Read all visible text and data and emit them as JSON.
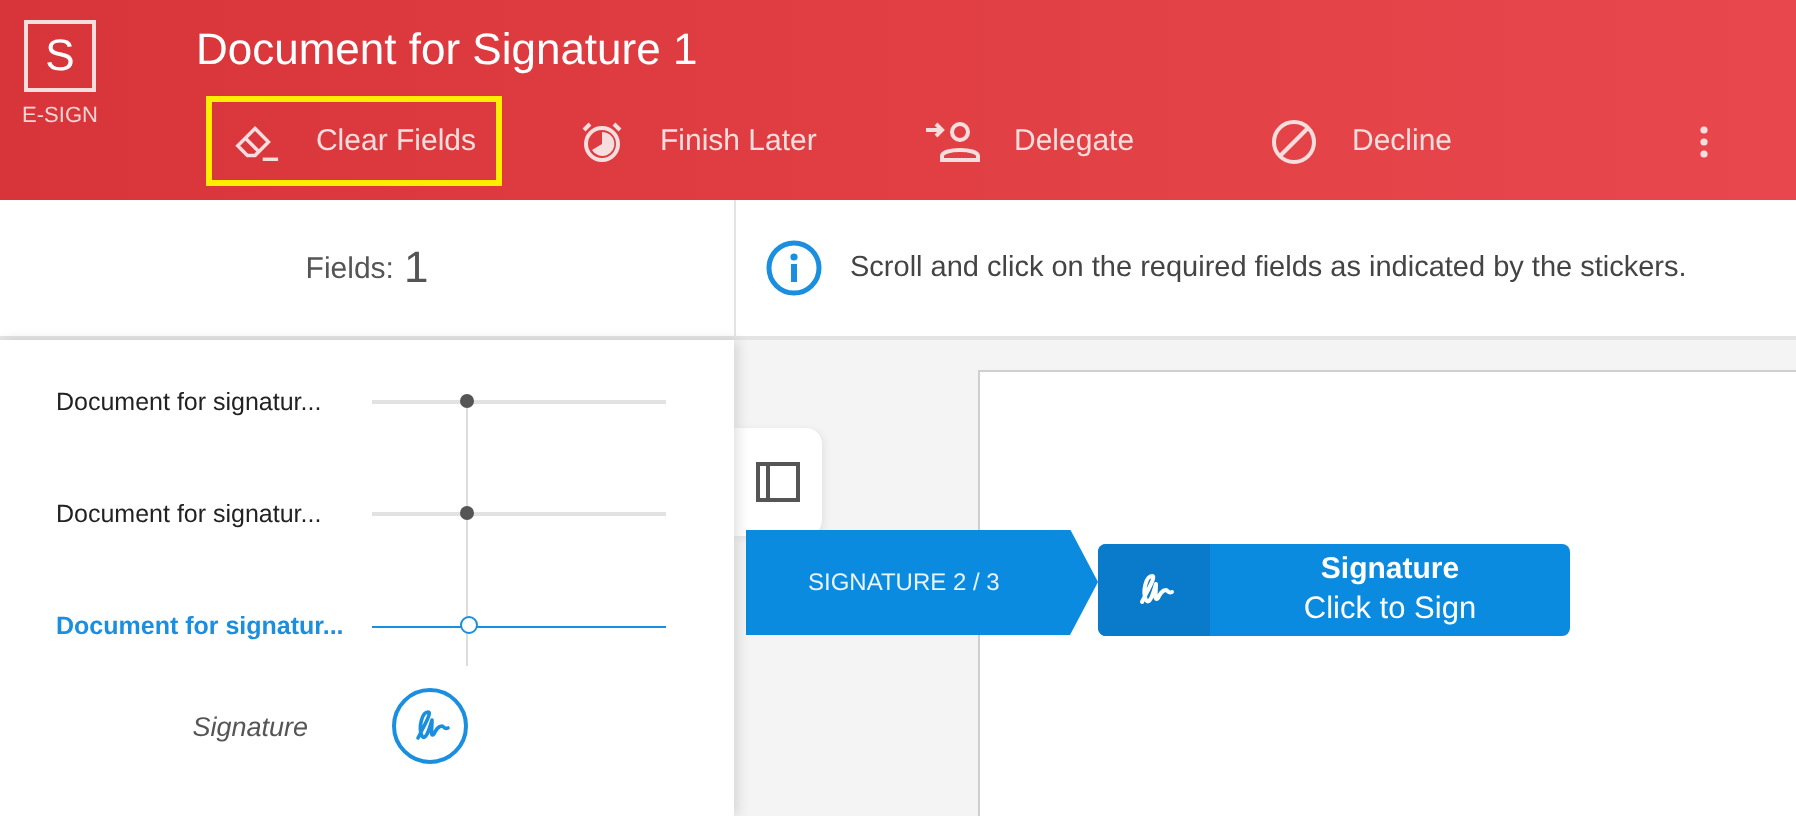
{
  "app": {
    "logo_letter": "S",
    "logo_label": "E-SIGN"
  },
  "document_title": "Document for Signature 1",
  "actions": [
    {
      "kind": "clear",
      "label": "Clear Fields",
      "highlighted": true
    },
    {
      "kind": "later",
      "label": "Finish Later",
      "highlighted": false
    },
    {
      "kind": "delegate",
      "label": "Delegate",
      "highlighted": false
    },
    {
      "kind": "decline",
      "label": "Decline",
      "highlighted": false
    }
  ],
  "fields": {
    "label": "Fields:",
    "count": "1"
  },
  "notice": "Scroll and click on the required fields as indicated by the stickers.",
  "documents": [
    {
      "title": "Document for signatur...",
      "selected": false
    },
    {
      "title": "Document for signatur...",
      "selected": false
    },
    {
      "title": "Document for signatur...",
      "selected": true,
      "fields": [
        {
          "kind": "signature",
          "label": "Signature"
        }
      ]
    }
  ],
  "sticker": {
    "label": "SIGNATURE 2 / 3"
  },
  "signature_field": {
    "title": "Signature",
    "action": "Click to Sign"
  }
}
